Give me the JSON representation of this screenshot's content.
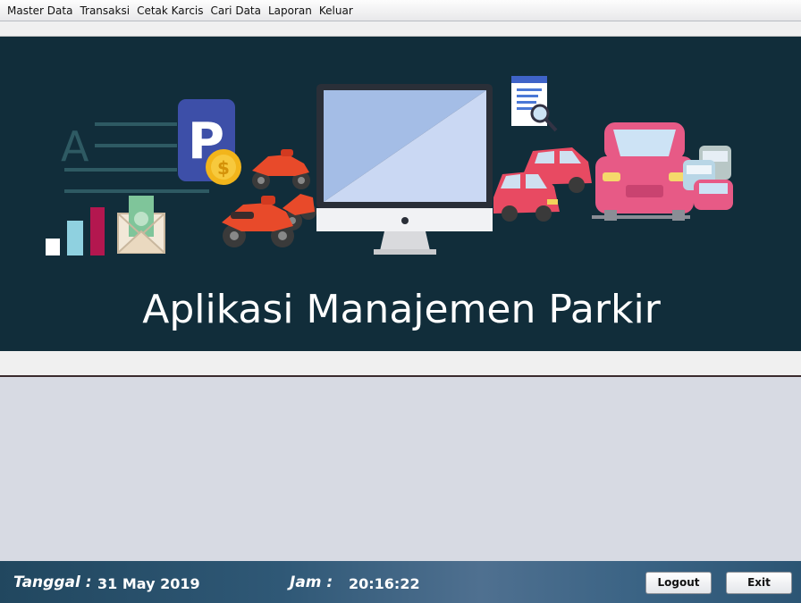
{
  "menu": {
    "items": [
      {
        "label": "Master Data"
      },
      {
        "label": "Transaksi"
      },
      {
        "label": "Cetak Karcis"
      },
      {
        "label": "Cari Data"
      },
      {
        "label": "Laporan"
      },
      {
        "label": "Keluar"
      }
    ]
  },
  "banner": {
    "title": "Aplikasi Manajemen Parkir",
    "background": "#112d3a",
    "parking_sign_letter": "P",
    "coin_symbol": "$",
    "chart_letter": "A"
  },
  "status": {
    "date_label": "Tanggal :",
    "date_value": "31 May 2019",
    "time_label": "Jam :",
    "time_value": "20:16:22",
    "logout_label": "Logout",
    "exit_label": "Exit"
  }
}
